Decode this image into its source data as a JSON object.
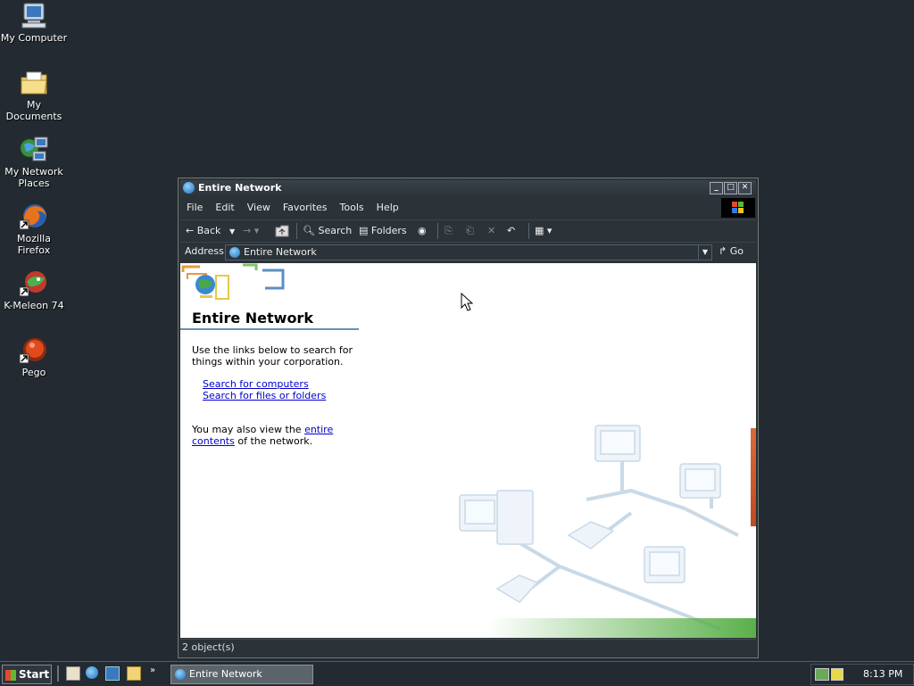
{
  "desktop": {
    "icons": [
      {
        "label": "My Computer",
        "icon": "computer-icon"
      },
      {
        "label": "My Documents",
        "icon": "folder-icon"
      },
      {
        "label": "My Network Places",
        "icon": "network-icon"
      },
      {
        "label": "Mozilla Firefox",
        "icon": "firefox-icon"
      },
      {
        "label": "K-Meleon 74",
        "icon": "kmeleon-icon"
      },
      {
        "label": "Pego",
        "icon": "pego-icon"
      }
    ]
  },
  "window": {
    "title": "Entire Network",
    "menu": [
      "File",
      "Edit",
      "View",
      "Favorites",
      "Tools",
      "Help"
    ],
    "toolbar": {
      "back": "Back",
      "search": "Search",
      "folders": "Folders"
    },
    "address": {
      "label": "Address",
      "value": "Entire Network",
      "go": "Go"
    },
    "content": {
      "heading": "Entire Network",
      "intro": "Use the links below to search for things within your corporation.",
      "links": [
        "Search for computers",
        "Search for files or folders"
      ],
      "outro_prefix": "You may also view the ",
      "outro_link": "entire contents",
      "outro_suffix": " of the network."
    },
    "status": "2 object(s)"
  },
  "taskbar": {
    "start": "Start",
    "active_item": "Entire Network",
    "clock": "8:13 PM"
  },
  "colors": {
    "desktop_bg": "#232a31",
    "window_frame": "#2b3238",
    "link": "#0000cc"
  }
}
